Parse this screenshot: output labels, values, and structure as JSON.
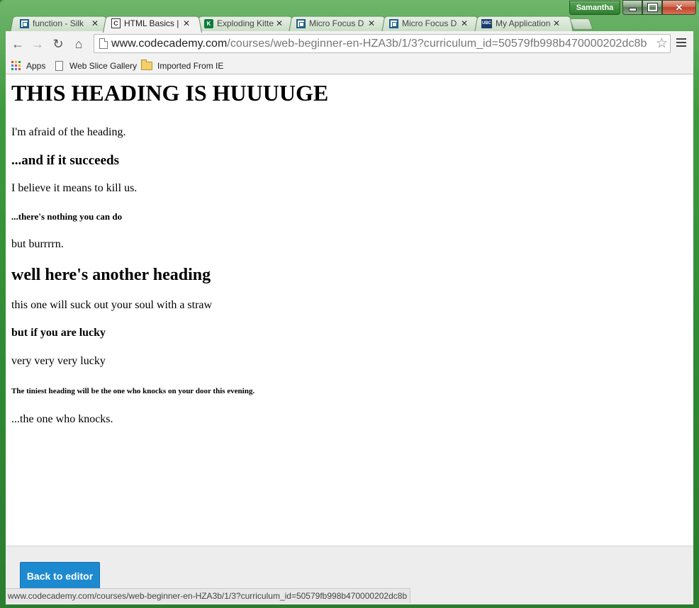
{
  "window": {
    "profile_name": "Samantha",
    "minimize": "minimize",
    "maximize": "maximize",
    "close": "close"
  },
  "tabs": [
    {
      "label": "function - Silk",
      "icon": "window-square-icon"
    },
    {
      "label": "HTML Basics |",
      "icon": "codecademy-icon",
      "active": true
    },
    {
      "label": "Exploding Kitte",
      "icon": "kickstarter-icon"
    },
    {
      "label": "Micro Focus D",
      "icon": "window-square-icon"
    },
    {
      "label": "Micro Focus D",
      "icon": "window-square-icon"
    },
    {
      "label": "My Application",
      "icon": "ubc-icon"
    }
  ],
  "toolbar": {
    "url_host": "www.codecademy.com",
    "url_path": "/courses/web-beginner-en-HZA3b/1/3?curriculum_id=50579fb998b470000202dc8b"
  },
  "bookmarks": [
    {
      "label": "Apps",
      "icon": "apps-grid-icon"
    },
    {
      "label": "Web Slice Gallery",
      "icon": "page-icon"
    },
    {
      "label": "Imported From IE",
      "icon": "folder-icon"
    }
  ],
  "document": {
    "h1": "THIS HEADING IS HUUUUGE",
    "p1": "I'm afraid of the heading.",
    "h3": "...and if it succeeds",
    "p2": "I believe it means to kill us.",
    "h5": "...there's nothing you can do",
    "p3": "but burrrrn.",
    "h2": "well here's another heading",
    "p4": "this one will suck out your soul with a straw",
    "h4": "but if you are lucky",
    "p5": "very very very lucky",
    "h6": "The tiniest heading will be the one who knocks on your door this evening.",
    "p6": "...the one who knocks."
  },
  "panel": {
    "back_button": "Back to editor"
  },
  "status": {
    "url": "www.codecademy.com/courses/web-beginner-en-HZA3b/1/3?curriculum_id=50579fb998b470000202dc8b"
  },
  "colors": {
    "accent_button": "#1d8ad0",
    "frame_green": "#2f8a33"
  }
}
